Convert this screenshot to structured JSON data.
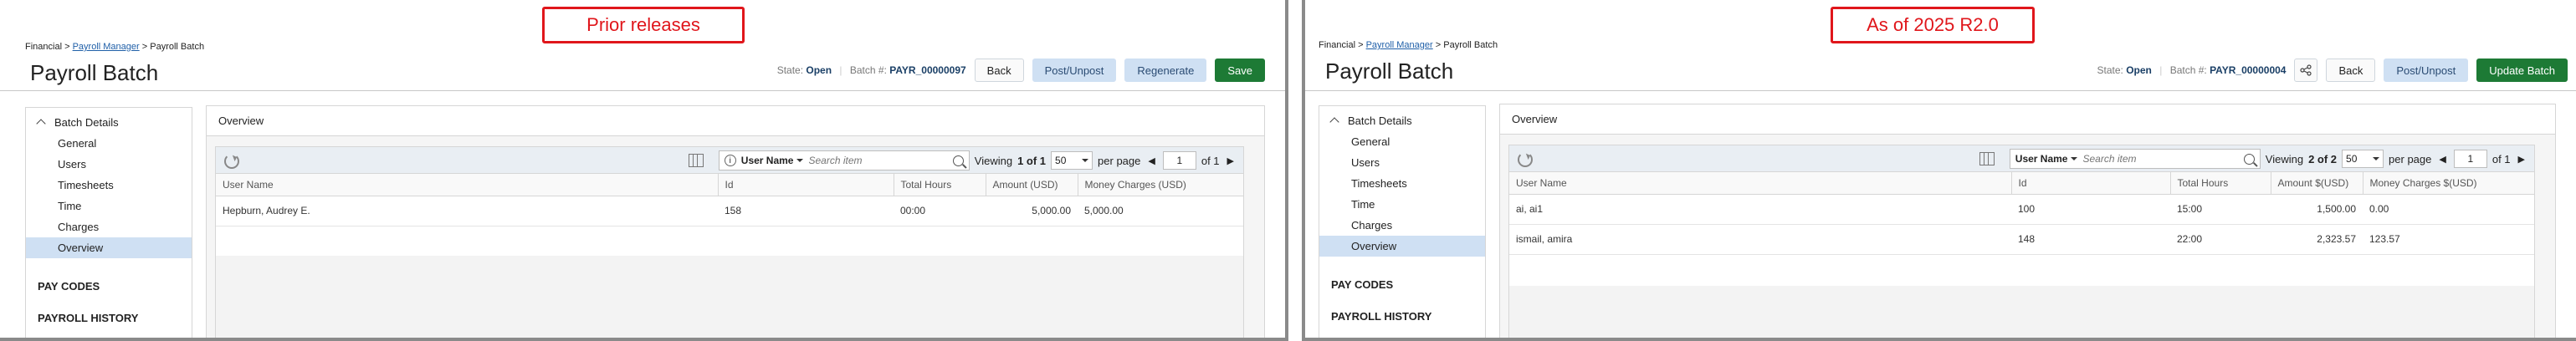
{
  "left": {
    "label": "Prior releases",
    "breadcrumb": {
      "root": "Financial",
      "sep1": ">",
      "link": "Payroll Manager",
      "sep2": ">",
      "current": "Payroll Batch"
    },
    "title": "Payroll Batch",
    "state_label": "State:",
    "state_value": "Open",
    "batch_label": "Batch #:",
    "batch_value": "PAYR_00000097",
    "buttons": {
      "back": "Back",
      "post": "Post/Unpost",
      "regenerate": "Regenerate",
      "save": "Save"
    },
    "sidebar": {
      "header": "Batch Details",
      "items": [
        "General",
        "Users",
        "Timesheets",
        "Time",
        "Charges",
        "Overview"
      ],
      "sections": [
        "PAY CODES",
        "PAYROLL HISTORY"
      ]
    },
    "content_title": "Overview",
    "search": {
      "field": "User Name",
      "placeholder": "Search item"
    },
    "pager": {
      "viewing": "Viewing",
      "range": "1 of 1",
      "per_page_value": "50",
      "per_page_label": "per page",
      "page": "1",
      "of": "of 1"
    },
    "columns": [
      "User Name",
      "Id",
      "Total Hours",
      "Amount (USD)",
      "Money Charges (USD)"
    ],
    "rows": [
      {
        "user": "Hepburn, Audrey E.",
        "id": "158",
        "hours": "00:00",
        "amount": "5,000.00",
        "charges": "5,000.00"
      }
    ]
  },
  "right": {
    "label": "As of 2025 R2.0",
    "breadcrumb": {
      "root": "Financial",
      "sep1": ">",
      "link": "Payroll Manager",
      "sep2": ">",
      "current": "Payroll Batch"
    },
    "title": "Payroll Batch",
    "state_label": "State:",
    "state_value": "Open",
    "batch_label": "Batch #:",
    "batch_value": "PAYR_00000004",
    "buttons": {
      "back": "Back",
      "post": "Post/Unpost",
      "update": "Update Batch"
    },
    "sidebar": {
      "header": "Batch Details",
      "items": [
        "General",
        "Users",
        "Timesheets",
        "Time",
        "Charges",
        "Overview"
      ],
      "sections": [
        "PAY CODES",
        "PAYROLL HISTORY"
      ]
    },
    "content_title": "Overview",
    "search": {
      "field": "User Name",
      "placeholder": "Search item"
    },
    "pager": {
      "viewing": "Viewing",
      "range": "2 of 2",
      "per_page_value": "50",
      "per_page_label": "per page",
      "page": "1",
      "of": "of 1"
    },
    "columns": [
      "User Name",
      "Id",
      "Total Hours",
      "Amount $(USD)",
      "Money Charges $(USD)"
    ],
    "rows": [
      {
        "user": "ai, ai1",
        "id": "100",
        "hours": "15:00",
        "amount": "1,500.00",
        "charges": "0.00"
      },
      {
        "user": "ismail, amira",
        "id": "148",
        "hours": "22:00",
        "amount": "2,323.57",
        "charges": "123.57"
      }
    ]
  },
  "icons": [
    "refresh-icon",
    "columns-icon",
    "info-icon",
    "search-icon",
    "share-icon",
    "chevron-up-icon",
    "chevron-left-icon",
    "chevron-right-icon"
  ]
}
